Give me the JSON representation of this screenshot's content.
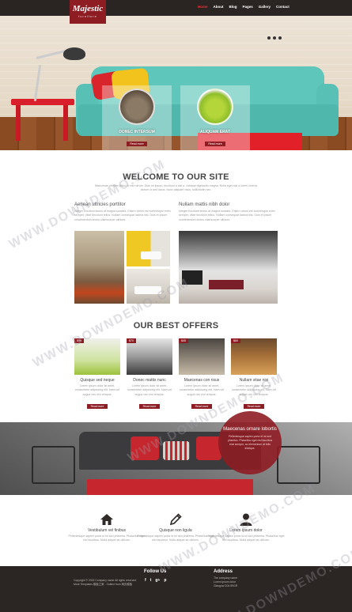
{
  "nav": {
    "logo_title": "Majestic",
    "logo_subtitle": "furniture",
    "menu": [
      "Home",
      "About",
      "Blog",
      "Pages",
      "Gallery",
      "Contact"
    ]
  },
  "hero": {
    "box1_title": "DONEC INTERSUM",
    "box2_title": "ALIQUAM ERAT",
    "button": "Read more"
  },
  "welcome": {
    "title": "WELCOME TO OUR SITE",
    "subtitle": "Maecenas pretium tellus et nisi rutrum. Duis mi ipsum, tincidunt a nisl a, volutpat dignissim magna. Nulla eget nisi a lorem viverra dictum ut sed lacus. Nunc aliquam risus, sollicitudin nec.",
    "col1_title": "Aenean ultricies porttitor",
    "col1_text": "Integer tincidunt lectus at magna sodales. Etiam rutrum est scelerisque enim semper, vitae tincidunt tellus. Nullam consequat lacinia nisi. Duis et ipsum condimentum lectus ullamcorper ultrices.",
    "col2_title": "Nullam mattis nibh dolor",
    "col2_text": "Integer tincidunt lectus at magna sodales. Etiam rutrum est scelerisque enim semper, vitae tincidunt tellus. Nullam consequat lacinia nisi. Duis et ipsum condimentum lectus ullamcorper ultrices."
  },
  "offers": {
    "title": "OUR BEST OFFERS",
    "button": "Read more",
    "desc": "Lorem ipsum dolor sit amet, consectetur adipiscing elit. Nam vel augue nec nisl tempus.",
    "items": [
      {
        "price": "$99",
        "title": "Quisque sed neque"
      },
      {
        "price": "$70",
        "title": "Donec mattis nunc"
      },
      {
        "price": "$45",
        "title": "Maecenas con risus"
      },
      {
        "price": "$60",
        "title": "Nullam vitae nisi"
      }
    ]
  },
  "banner": {
    "title": "Maecenas ornare lobortis",
    "text": "Pellentesque sapien porta id mi sed pharetra. Phasellus eget nisl faucibus erat semper, ac elementum at felis tristique."
  },
  "features": {
    "desc": "Pellentesque sapien porta id mi sed pharetra. Phasellus eget nisl faucibus. Nulla aliquet ac ultrices.",
    "items": [
      {
        "icon": "home-icon",
        "title": "Vestibulum vel finibus"
      },
      {
        "icon": "pencil-icon",
        "title": "Quisque non ligula"
      },
      {
        "icon": "user-icon",
        "title": "Lorem ipsum dolor"
      }
    ]
  },
  "footer": {
    "copyright": "Copyright © 2015 Company name All rights reserved More Templates 模板之家 - Collect from 网页模板",
    "follow_title": "Follow Us",
    "social": [
      "f",
      "t",
      "g+",
      "p"
    ],
    "address_title": "Address",
    "address_lines": [
      "The company name",
      "Lorem ipsum dolor",
      "Glasgow D04 89GR"
    ]
  },
  "watermark": "WWW.DOWNDEMO.COM",
  "colors": {
    "accent": "#8e1d23",
    "dark": "#2a2422",
    "sofa": "#5fc6bb"
  }
}
